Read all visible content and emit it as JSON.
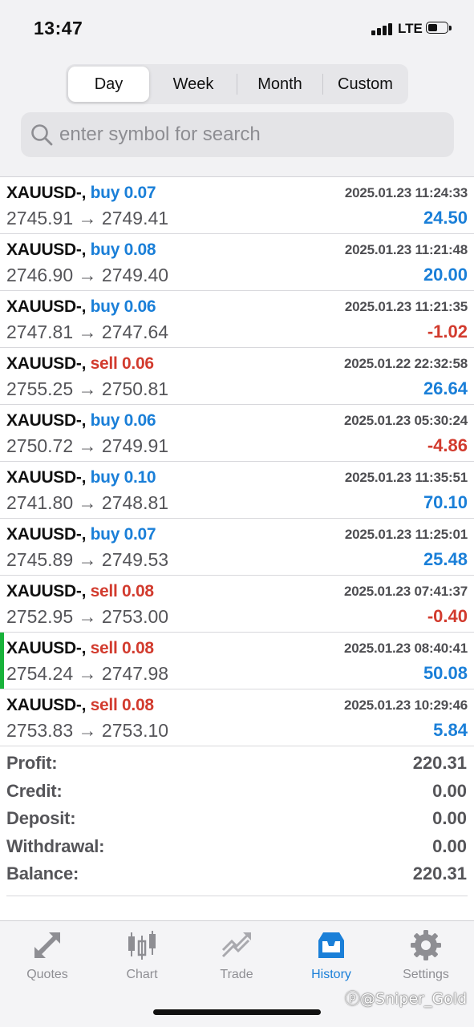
{
  "status": {
    "time": "13:47",
    "network": "LTE"
  },
  "periods": {
    "tabs": [
      "Day",
      "Week",
      "Month",
      "Custom"
    ],
    "active": "Day"
  },
  "search": {
    "placeholder": "enter symbol for search"
  },
  "trades": [
    {
      "symbol": "XAUUSD-,",
      "side": "buy",
      "lots": "0.07",
      "time": "2025.01.23 11:24:33",
      "open": "2745.91",
      "close": "2749.41",
      "profit": "24.50",
      "arrow": "→"
    },
    {
      "symbol": "XAUUSD-,",
      "side": "buy",
      "lots": "0.08",
      "time": "2025.01.23 11:21:48",
      "open": "2746.90",
      "close": "2749.40",
      "profit": "20.00",
      "arrow": "→"
    },
    {
      "symbol": "XAUUSD-,",
      "side": "buy",
      "lots": "0.06",
      "time": "2025.01.23 11:21:35",
      "open": "2747.81",
      "close": "2747.64",
      "profit": "-1.02",
      "arrow": "→"
    },
    {
      "symbol": "XAUUSD-,",
      "side": "sell",
      "lots": "0.06",
      "time": "2025.01.22 22:32:58",
      "open": "2755.25",
      "close": "2750.81",
      "profit": "26.64",
      "arrow": "→"
    },
    {
      "symbol": "XAUUSD-,",
      "side": "buy",
      "lots": "0.06",
      "time": "2025.01.23 05:30:24",
      "open": "2750.72",
      "close": "2749.91",
      "profit": "-4.86",
      "arrow": "→"
    },
    {
      "symbol": "XAUUSD-,",
      "side": "buy",
      "lots": "0.10",
      "time": "2025.01.23 11:35:51",
      "open": "2741.80",
      "close": "2748.81",
      "profit": "70.10",
      "arrow": "→"
    },
    {
      "symbol": "XAUUSD-,",
      "side": "buy",
      "lots": "0.07",
      "time": "2025.01.23 11:25:01",
      "open": "2745.89",
      "close": "2749.53",
      "profit": "25.48",
      "arrow": "→"
    },
    {
      "symbol": "XAUUSD-,",
      "side": "sell",
      "lots": "0.08",
      "time": "2025.01.23 07:41:37",
      "open": "2752.95",
      "close": "2753.00",
      "profit": "-0.40",
      "arrow": "→"
    },
    {
      "symbol": "XAUUSD-,",
      "side": "sell",
      "lots": "0.08",
      "time": "2025.01.23 08:40:41",
      "open": "2754.24",
      "close": "2747.98",
      "profit": "50.08",
      "arrow": "→",
      "highlighted": true
    },
    {
      "symbol": "XAUUSD-,",
      "side": "sell",
      "lots": "0.08",
      "time": "2025.01.23 10:29:46",
      "open": "2753.83",
      "close": "2753.10",
      "profit": "5.84",
      "arrow": "→"
    }
  ],
  "summary": [
    {
      "label": "Profit:",
      "value": "220.31"
    },
    {
      "label": "Credit:",
      "value": "0.00"
    },
    {
      "label": "Deposit:",
      "value": "0.00"
    },
    {
      "label": "Withdrawal:",
      "value": "0.00"
    },
    {
      "label": "Balance:",
      "value": "220.31"
    }
  ],
  "tabbar": [
    {
      "label": "Quotes",
      "icon": "quotes-icon"
    },
    {
      "label": "Chart",
      "icon": "chart-icon"
    },
    {
      "label": "Trade",
      "icon": "trade-icon"
    },
    {
      "label": "History",
      "icon": "history-icon",
      "active": true
    },
    {
      "label": "Settings",
      "icon": "settings-icon"
    }
  ],
  "colors": {
    "buy": "#1a7fd8",
    "sell": "#d23b2e",
    "active_tab": "#1a7fd8",
    "highlight_marker": "#18b23a"
  },
  "watermark": "@Sniper_Gold"
}
